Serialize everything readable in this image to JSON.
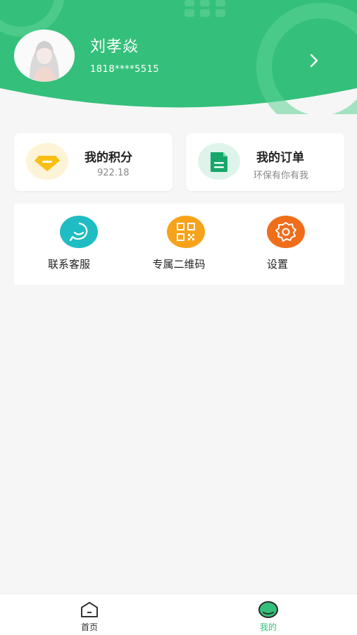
{
  "user": {
    "name": "刘孝焱",
    "phone": "1818****5515"
  },
  "cards": {
    "points": {
      "title": "我的积分",
      "value": "922.18"
    },
    "orders": {
      "title": "我的订单",
      "subtitle": "环保有你有我"
    }
  },
  "services": [
    {
      "label": "联系客服",
      "icon": "chat-icon",
      "color": "#20bcc4"
    },
    {
      "label": "专属二维码",
      "icon": "qr-code-icon",
      "color": "#f7a21b"
    },
    {
      "label": "设置",
      "icon": "gear-icon",
      "color": "#f06d1a"
    }
  ],
  "tabbar": {
    "home": {
      "label": "首页"
    },
    "mine": {
      "label": "我的"
    }
  },
  "colors": {
    "brand": "#34c07a",
    "active_tab": "#34c07a",
    "inactive_tab": "#333333"
  }
}
